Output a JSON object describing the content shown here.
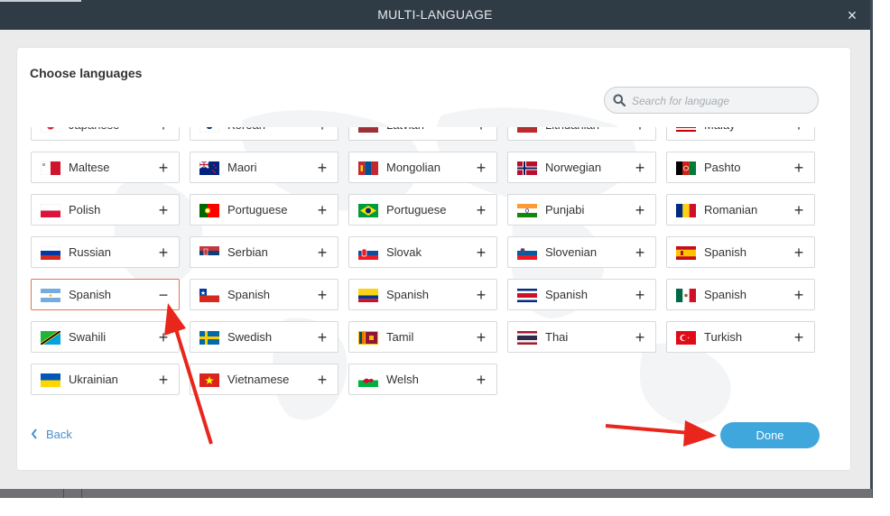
{
  "header": {
    "title": "MULTI-LANGUAGE",
    "close": "×"
  },
  "panel": {
    "title": "Choose languages"
  },
  "search": {
    "placeholder": "Search for language",
    "icon": "search-icon"
  },
  "languages": [
    {
      "label": "Japanese",
      "action": "+",
      "flag": "japan"
    },
    {
      "label": "Korean",
      "action": "+",
      "flag": "korea"
    },
    {
      "label": "Latvian",
      "action": "+",
      "flag": "latvia"
    },
    {
      "label": "Lithuanian",
      "action": "+",
      "flag": "lithuania"
    },
    {
      "label": "Malay",
      "action": "+",
      "flag": "malaysia"
    },
    {
      "label": "Maltese",
      "action": "+",
      "flag": "malta"
    },
    {
      "label": "Maori",
      "action": "+",
      "flag": "new-zealand"
    },
    {
      "label": "Mongolian",
      "action": "+",
      "flag": "mongolia"
    },
    {
      "label": "Norwegian",
      "action": "+",
      "flag": "norway"
    },
    {
      "label": "Pashto",
      "action": "+",
      "flag": "afghanistan"
    },
    {
      "label": "Polish",
      "action": "+",
      "flag": "poland"
    },
    {
      "label": "Portuguese",
      "action": "+",
      "flag": "portugal"
    },
    {
      "label": "Portuguese",
      "action": "+",
      "flag": "brazil"
    },
    {
      "label": "Punjabi",
      "action": "+",
      "flag": "india"
    },
    {
      "label": "Romanian",
      "action": "+",
      "flag": "romania"
    },
    {
      "label": "Russian",
      "action": "+",
      "flag": "russia"
    },
    {
      "label": "Serbian",
      "action": "+",
      "flag": "serbia"
    },
    {
      "label": "Slovak",
      "action": "+",
      "flag": "slovakia"
    },
    {
      "label": "Slovenian",
      "action": "+",
      "flag": "slovenia"
    },
    {
      "label": "Spanish",
      "action": "+",
      "flag": "spain"
    },
    {
      "label": "Spanish",
      "action": "−",
      "flag": "argentina",
      "selected": true
    },
    {
      "label": "Spanish",
      "action": "+",
      "flag": "chile"
    },
    {
      "label": "Spanish",
      "action": "+",
      "flag": "colombia"
    },
    {
      "label": "Spanish",
      "action": "+",
      "flag": "costa-rica"
    },
    {
      "label": "Spanish",
      "action": "+",
      "flag": "mexico"
    },
    {
      "label": "Swahili",
      "action": "+",
      "flag": "tanzania"
    },
    {
      "label": "Swedish",
      "action": "+",
      "flag": "sweden"
    },
    {
      "label": "Tamil",
      "action": "+",
      "flag": "sri-lanka"
    },
    {
      "label": "Thai",
      "action": "+",
      "flag": "thailand"
    },
    {
      "label": "Turkish",
      "action": "+",
      "flag": "turkey"
    },
    {
      "label": "Ukrainian",
      "action": "+",
      "flag": "ukraine"
    },
    {
      "label": "Vietnamese",
      "action": "+",
      "flag": "vietnam"
    },
    {
      "label": "Welsh",
      "action": "+",
      "flag": "wales"
    }
  ],
  "footer": {
    "back": "Back",
    "done": "Done"
  },
  "colors": {
    "accent": "#3fa7dc",
    "selected_border": "#e6724e",
    "header": "#2f3b45",
    "annotation_arrow": "#e8261b"
  }
}
